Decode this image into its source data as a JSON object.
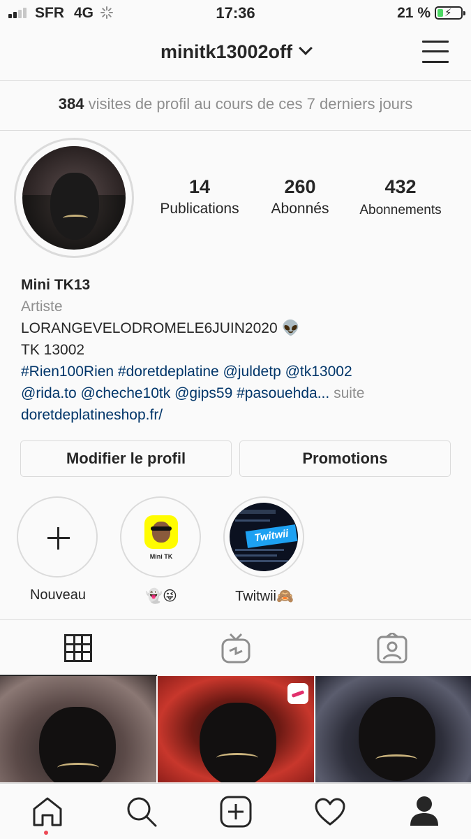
{
  "status_bar": {
    "carrier": "SFR",
    "network": "4G",
    "time": "17:36",
    "battery_percent": "21 %",
    "battery_level": 0.21
  },
  "header": {
    "username": "minitk13002off"
  },
  "insights": {
    "visits_count": "384",
    "visits_text": " visites de profil au cours de ces 7 derniers jours"
  },
  "stats": [
    {
      "value": "14",
      "label": "Publications"
    },
    {
      "value": "260",
      "label": "Abonnés"
    },
    {
      "value": "432",
      "label": "Abonnements"
    }
  ],
  "bio": {
    "name": "Mini TK13",
    "category": "Artiste",
    "line1": "LORANGEVELODROMELE6JUIN2020 👽",
    "line2": "TK 13002",
    "line3": "#Rien100Rien #doretdeplatine  @juldetp @tk13002",
    "line4": "@rida.to @cheche10tk @gips59 #pasouehda...",
    "more": " suite",
    "website": "doretdeplatineshop.fr/"
  },
  "buttons": {
    "edit_profile": "Modifier le profil",
    "promotions": "Promotions"
  },
  "highlights": [
    {
      "label": "Nouveau",
      "icon": "plus-icon"
    },
    {
      "label": "👻😜",
      "thumb_caption": "Mini TK"
    },
    {
      "label": "Twitwii🙈",
      "thumb_badge": "Twitwii"
    }
  ],
  "tabs": [
    {
      "icon": "grid-icon",
      "active": true
    },
    {
      "icon": "igtv-icon",
      "active": false
    },
    {
      "icon": "tagged-icon",
      "active": false
    }
  ],
  "bottom_nav": [
    {
      "icon": "home-icon"
    },
    {
      "icon": "search-icon"
    },
    {
      "icon": "new-post-icon"
    },
    {
      "icon": "activity-heart-icon"
    },
    {
      "icon": "profile-icon"
    }
  ],
  "colors": {
    "link": "#003569",
    "muted": "#8e8e8e",
    "border": "#dbdbdb",
    "notification_dot": "#ed4956",
    "battery_green": "#4cd964"
  }
}
